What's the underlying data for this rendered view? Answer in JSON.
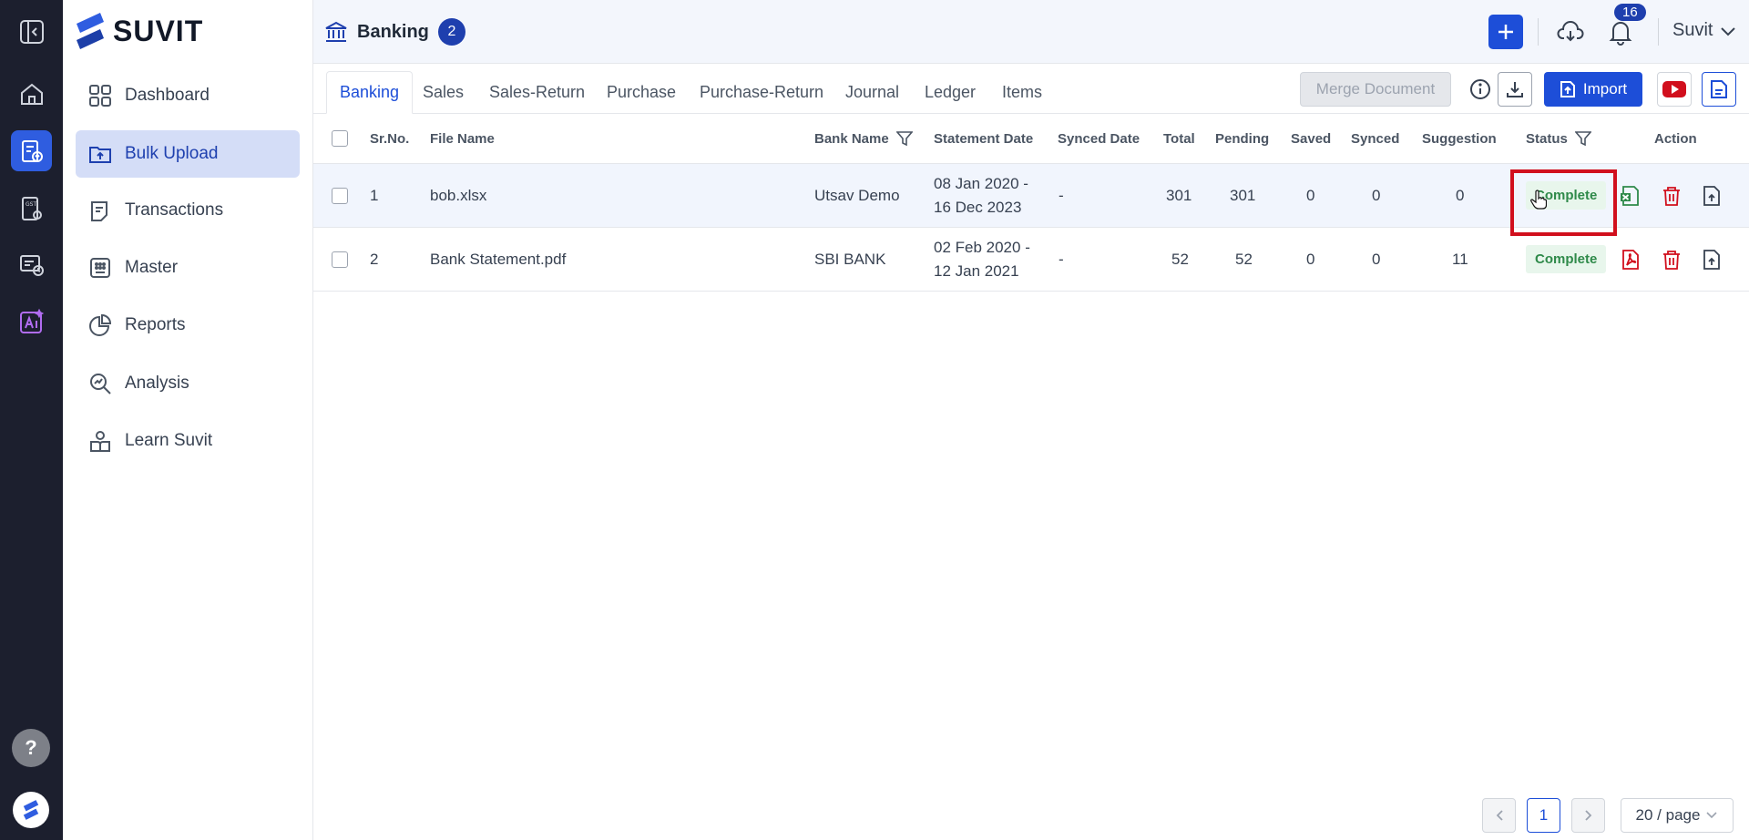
{
  "brand": {
    "name": "SUVIT"
  },
  "sidebar": {
    "items": [
      {
        "label": "Dashboard"
      },
      {
        "label": "Bulk Upload"
      },
      {
        "label": "Transactions"
      },
      {
        "label": "Master"
      },
      {
        "label": "Reports"
      },
      {
        "label": "Analysis"
      },
      {
        "label": "Learn Suvit"
      }
    ]
  },
  "rail": {
    "help_label": "?"
  },
  "header": {
    "title": "Banking",
    "badge": "2",
    "notification_count": "16",
    "user": "Suvit"
  },
  "tabs": [
    "Banking",
    "Sales",
    "Sales-Return",
    "Purchase",
    "Purchase-Return",
    "Journal",
    "Ledger",
    "Items"
  ],
  "toolbar": {
    "merge_label": "Merge Document",
    "import_label": "Import"
  },
  "table": {
    "columns": [
      "Sr.No.",
      "File Name",
      "Bank Name",
      "Statement Date",
      "Synced Date",
      "Total",
      "Pending",
      "Saved",
      "Synced",
      "Suggestion",
      "Status",
      "Action"
    ],
    "rows": [
      {
        "sr": "1",
        "file": "bob.xlsx",
        "bank": "Utsav Demo",
        "date_from": "08 Jan 2020 -",
        "date_to": "16 Dec 2023",
        "synced": "-",
        "total": "301",
        "pending": "301",
        "saved": "0",
        "synced_count": "0",
        "suggestion": "0",
        "status": "Complete",
        "file_type": "excel"
      },
      {
        "sr": "2",
        "file": "Bank Statement.pdf",
        "bank": "SBI BANK",
        "date_from": "02 Feb 2020 -",
        "date_to": "12 Jan 2021",
        "synced": "-",
        "total": "52",
        "pending": "52",
        "saved": "0",
        "synced_count": "0",
        "suggestion": "11",
        "status": "Complete",
        "file_type": "pdf"
      }
    ]
  },
  "pagination": {
    "current": "1",
    "page_size": "20 / page"
  },
  "colors": {
    "accent": "#1d4ed8",
    "rail_bg": "#1c1f2e",
    "status_green": "#2f8a4a",
    "danger": "#d10f1d"
  }
}
